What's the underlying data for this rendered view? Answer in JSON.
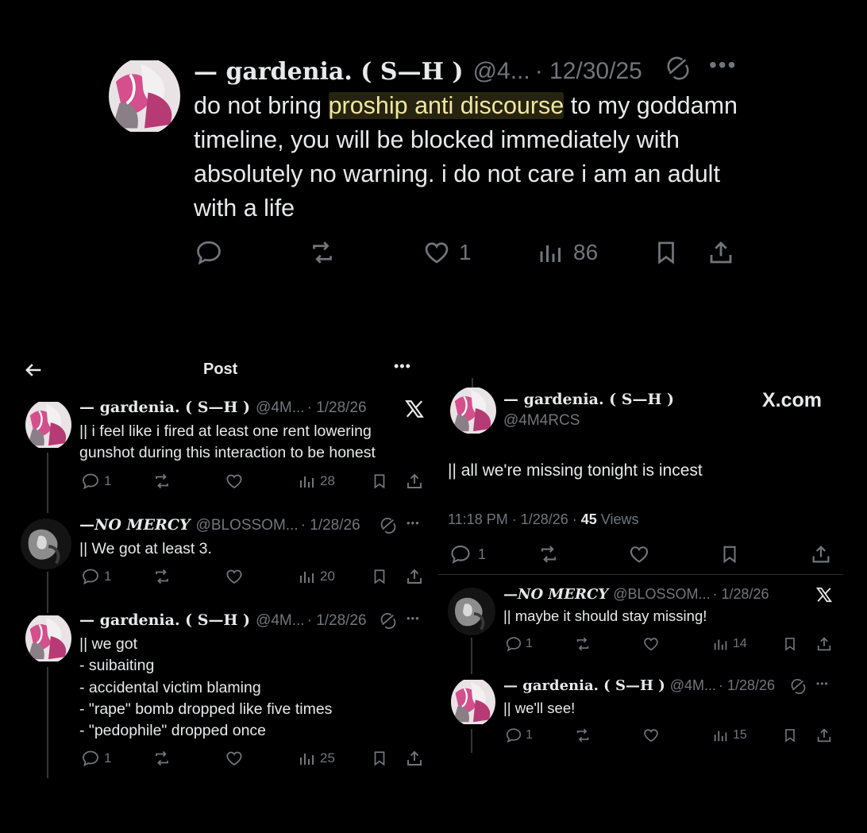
{
  "top_post": {
    "author": "— gardenia. ( S—H )",
    "handle": "@4...",
    "date": "· 12/30/25",
    "text_before": "do not bring ",
    "text_highlight": "proship anti discourse",
    "text_after": " to my goddamn timeline, you will be blocked immediately with absolutely no warning. i do not care i am an adult with a life",
    "likes": "1",
    "views": "86",
    "more_icon": "more-icon"
  },
  "left_panel": {
    "header_title": "Post",
    "posts": [
      {
        "author": "— gardenia. ( S—H )",
        "handle": "@4M...",
        "date": "· 1/28/26",
        "text": "|| i feel like i fired at least one rent lowering gunshot during this interaction to be honest",
        "replies": "1",
        "views": "28"
      },
      {
        "author": "—NO MERCY",
        "handle": "@BLOSSOM...",
        "date": "· 1/28/26",
        "text": "|| We got at least 3.",
        "replies": "1",
        "views": "20"
      },
      {
        "author": "— gardenia. ( S—H )",
        "handle": "@4M...",
        "date": "· 1/28/26",
        "lines": [
          "|| we got",
          "- suibaiting",
          "- accidental victim blaming",
          "- \"rape\" bomb dropped like five times",
          "- \"pedophile\" dropped once"
        ],
        "replies": "1",
        "views": "25"
      }
    ]
  },
  "right_panel": {
    "site_label": "X.com",
    "main": {
      "author": "— gardenia. ( S—H )",
      "handle": "@4M4RCS",
      "text": "|| all we're missing tonight is incest",
      "time": "11:18 PM · 1/28/26 · ",
      "views_count": "45",
      "views_label": " Views",
      "replies": "1"
    },
    "replies": [
      {
        "author": "—NO MERCY",
        "handle": "@BLOSSOM...",
        "date": "· 1/28/26",
        "text": "|| maybe it should stay missing!",
        "replies": "1",
        "views": "14"
      },
      {
        "author": "— gardenia. ( S—H )",
        "handle": "@4M...",
        "date": "· 1/28/26",
        "text": "|| we'll see!",
        "replies": "1",
        "views": "15"
      }
    ]
  }
}
